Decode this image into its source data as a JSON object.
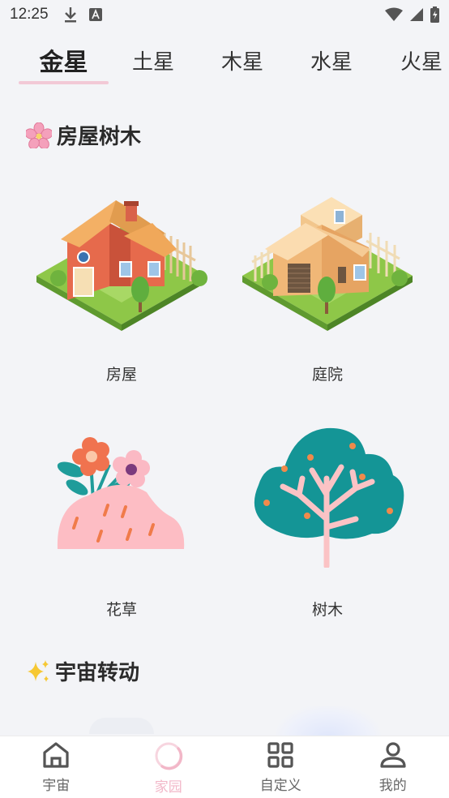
{
  "status_bar": {
    "time": "12:25"
  },
  "tabs": [
    {
      "label": "金星",
      "active": true
    },
    {
      "label": "土星",
      "active": false
    },
    {
      "label": "木星",
      "active": false
    },
    {
      "label": "水星",
      "active": false
    },
    {
      "label": "火星",
      "active": false
    }
  ],
  "sections": [
    {
      "title": "房屋树木",
      "icon": "cherry-blossom-icon",
      "items": [
        {
          "label": "房屋",
          "icon": "house-icon"
        },
        {
          "label": "庭院",
          "icon": "courtyard-icon"
        },
        {
          "label": "花草",
          "icon": "flowers-grass-icon"
        },
        {
          "label": "树木",
          "icon": "tree-icon"
        }
      ]
    },
    {
      "title": "宇宙转动",
      "icon": "sparkles-icon"
    }
  ],
  "bottom_nav": [
    {
      "label": "宇宙",
      "icon": "home-icon",
      "active": false
    },
    {
      "label": "家园",
      "icon": "ring-icon",
      "active": true
    },
    {
      "label": "自定义",
      "icon": "grid-icon",
      "active": false
    },
    {
      "label": "我的",
      "icon": "user-icon",
      "active": false
    }
  ],
  "colors": {
    "accent": "#f2b7c8",
    "underline": "#f2c9d6",
    "background": "#f3f4f7"
  }
}
